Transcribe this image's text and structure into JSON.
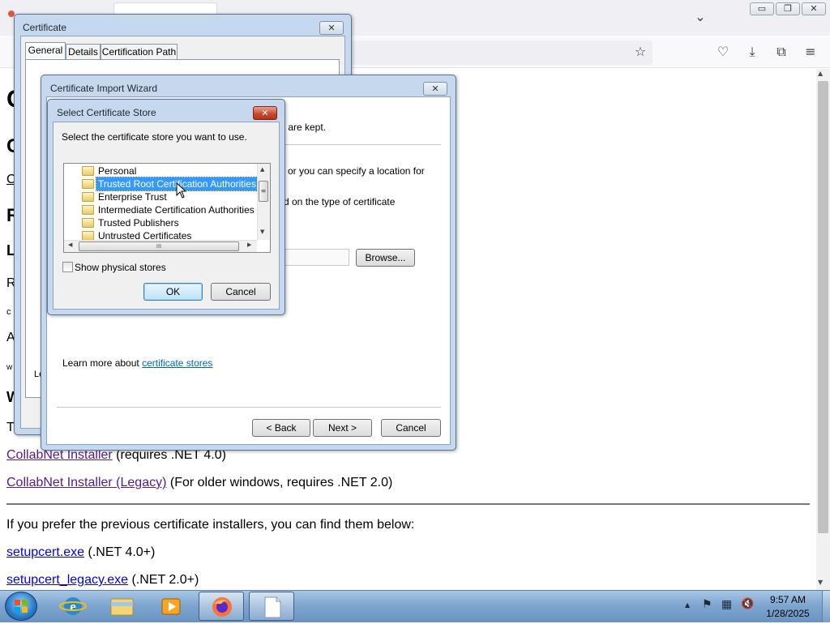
{
  "browser": {
    "minimize_glyph": "▭",
    "restore_glyph": "❐",
    "close_glyph": "✕",
    "list_tabs_glyph": "⌄",
    "bookmark_glyph": "☆",
    "pocket_glyph": "♡",
    "downloads_glyph": "⤓",
    "extensions_glyph": "⧉",
    "menu_glyph": "≡"
  },
  "page": {
    "partial_lines": [
      "C",
      "C",
      "C",
      "R",
      "L",
      "R",
      "c",
      "A",
      "w",
      "W",
      "T"
    ],
    "installer_link": "CollabNet Installer",
    "installer_note": " (requires .NET 4.0)",
    "legacy_link": "CollabNet Installer (Legacy)",
    "legacy_note": " (For older windows, requires .NET 2.0)",
    "previous_text": "If you prefer the previous certificate installers, you can find them below:",
    "setupcert_link": "setupcert.exe",
    "setupcert_note": " (.NET 4.0+)",
    "setupcert_legacy_link": "setupcert_legacy.exe",
    "setupcert_legacy_note": " (.NET 2.0+)",
    "scroll_up": "▲",
    "scroll_down": "▼"
  },
  "certificate_window": {
    "title": "Certificate",
    "close_glyph": "✕",
    "tabs": [
      "General",
      "Details",
      "Certification Path"
    ],
    "fragment": "Le"
  },
  "import_wizard": {
    "title": "Certificate Import Wizard",
    "close_glyph": "✕",
    "partial_text_1": "s are kept.",
    "partial_text_2": "or you can specify a location for",
    "partial_text_3": "d on the type of certificate",
    "browse_label": "Browse...",
    "learn_more_text": "Learn more about ",
    "learn_more_link": "certificate stores",
    "back_label": "< Back",
    "next_label": "Next >",
    "cancel_label": "Cancel"
  },
  "select_store_dialog": {
    "title": "Select Certificate Store",
    "close_glyph": "✕",
    "instruction": "Select the certificate store you want to use.",
    "stores": [
      "Personal",
      "Trusted Root Certification Authorities",
      "Enterprise Trust",
      "Intermediate Certification Authorities",
      "Trusted Publishers",
      "Untrusted Certificates"
    ],
    "selected_store": "Trusted Root Certification Authorities",
    "scroll_up": "▲",
    "scroll_down": "▼",
    "scroll_left": "◀",
    "scroll_right": "▶",
    "thumb_grip": "≡",
    "h_thumb_grip": "III",
    "show_physical_label": "Show physical stores",
    "show_physical_checked": false,
    "ok_label": "OK",
    "cancel_label": "Cancel"
  },
  "taskbar": {
    "clock_time": "9:57 AM",
    "clock_date": "1/28/2025",
    "tray_up": "▲",
    "tray_flag": "⚑",
    "tray_network": "▦",
    "tray_volume": "🔇"
  },
  "colors": {
    "selection": "#3399ff",
    "link_visited": "#551a8b",
    "link_blue": "#0066cc",
    "dialog_frame": "#c6d8ee",
    "taskbar": "#7ea6d0"
  }
}
